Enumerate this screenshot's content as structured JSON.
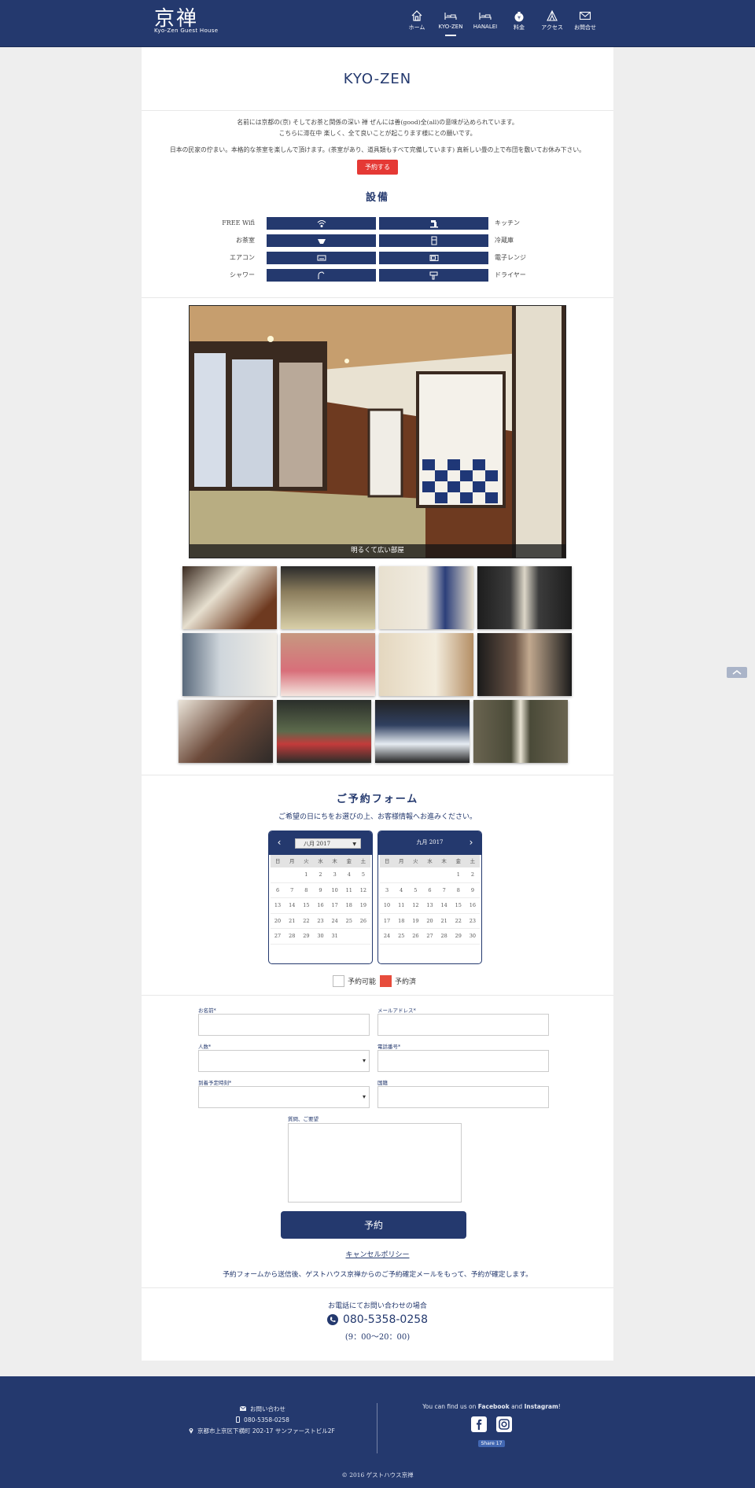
{
  "brand": {
    "kanji": "京禅",
    "sub": "Kyo-Zen Guest House"
  },
  "nav": [
    {
      "label": "ホーム",
      "icon": "home-icon"
    },
    {
      "label": "KYO-ZEN",
      "icon": "bed-icon"
    },
    {
      "label": "HANALEI",
      "icon": "bed-icon"
    },
    {
      "label": "料金",
      "icon": "money-bag-icon"
    },
    {
      "label": "アクセス",
      "icon": "map-icon"
    },
    {
      "label": "お問合せ",
      "icon": "envelope-icon"
    }
  ],
  "page": {
    "title": "KYO-ZEN",
    "intro_line1": "名前には京都の(京) そしてお茶と関係の深い 禅 ぜんには善(good)全(all)の意味が込められています。",
    "intro_line2": "こちらに滞在中 楽しく、全て良いことが起こります様にとの願いです。",
    "intro_line3": "日本の民家の佇まい。本格的な茶室を楽しんで頂けます。(茶室があり、道具類もすべて完備しています) 真新しい畳の上で布団を敷いてお休み下さい。",
    "reserve_button": "予約する",
    "facilities_heading": "設備"
  },
  "facilities": [
    {
      "left": "FREE Wifi",
      "right": "キッチン",
      "left_icon": "wifi-icon",
      "right_icon": "faucet-icon"
    },
    {
      "left": "お茶室",
      "right": "冷蔵庫",
      "left_icon": "tea-bowl-icon",
      "right_icon": "fridge-icon"
    },
    {
      "left": "エアコン",
      "right": "電子レンジ",
      "left_icon": "air-conditioner-icon",
      "right_icon": "microwave-icon"
    },
    {
      "left": "シャワー",
      "right": "ドライヤー",
      "left_icon": "shower-icon",
      "right_icon": "hair-dryer-icon"
    }
  ],
  "gallery": {
    "caption": "明るくて広い部屋",
    "thumbs": [
      "tatami-room",
      "tatami-futon",
      "room-door",
      "scroll-art",
      "shower-room",
      "toilet",
      "fridge-corner",
      "entrance",
      "tea-shelf",
      "tea-bowls",
      "blue-bowl",
      "calligraphy"
    ]
  },
  "booking": {
    "heading": "ご予約フォーム",
    "subtitle": "ご希望の日にちをお選びの上、お客様情報へお進みください。",
    "weekdays": [
      "日",
      "月",
      "火",
      "水",
      "木",
      "金",
      "土"
    ],
    "calendars": [
      {
        "month": "八月 2017",
        "days": [
          "",
          "",
          "1",
          "2",
          "3",
          "4",
          "5",
          "6",
          "7",
          "8",
          "9",
          "10",
          "11",
          "12",
          "13",
          "14",
          "15",
          "16",
          "17",
          "18",
          "19",
          "20",
          "21",
          "22",
          "23",
          "24",
          "25",
          "26",
          "27",
          "28",
          "29",
          "30",
          "31",
          "",
          ""
        ]
      },
      {
        "month": "九月 2017",
        "days": [
          "",
          "",
          "",
          "",
          "",
          "1",
          "2",
          "3",
          "4",
          "5",
          "6",
          "7",
          "8",
          "9",
          "10",
          "11",
          "12",
          "13",
          "14",
          "15",
          "16",
          "17",
          "18",
          "19",
          "20",
          "21",
          "22",
          "23",
          "24",
          "25",
          "26",
          "27",
          "28",
          "29",
          "30"
        ]
      }
    ],
    "legend_available": "予約可能",
    "legend_reserved": "予約済",
    "form": {
      "name": "お名前*",
      "email": "メールアドレス*",
      "guests": "人数*",
      "phone": "電話番号*",
      "arrival": "到着予定時刻*",
      "nationality": "国籍",
      "message": "質問、ご要望"
    },
    "submit": "予約",
    "cancel_policy": "キャンセルポリシー",
    "confirm_note": "予約フォームから送信後、ゲストハウス京禅からのご予約確定メールをもって、予約が確定します。",
    "phone_heading": "お電話にてお問い合わせの場合",
    "phone_number": "080-5358-0258",
    "phone_hours": "(9：00～20：00)"
  },
  "footer": {
    "contact": "お問い合わせ",
    "phone": "080-5358-0258",
    "address": "京都市上京区下横町 202-17 サンファーストビル2F",
    "social_prefix": "You can find us on ",
    "facebook": "Facebook",
    "and": " and ",
    "instagram": "Instagram",
    "social_suffix": "!",
    "share": "Share 17",
    "copyright": "© 2016 ゲストハウス京禅"
  },
  "colors": {
    "navy": "#24396e",
    "accent_red": "#e53935"
  }
}
